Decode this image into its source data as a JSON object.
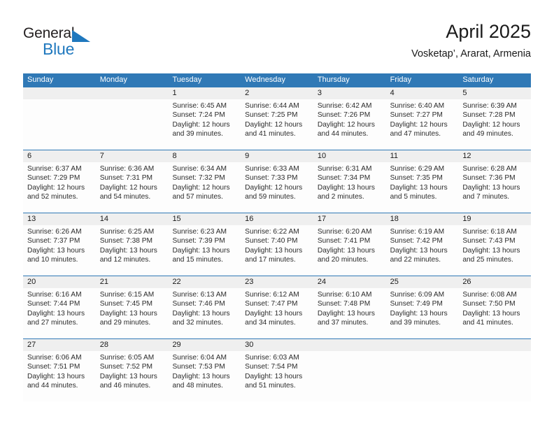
{
  "brand": {
    "name_part1": "General",
    "name_part2": "Blue",
    "triangle_color": "#1f78be"
  },
  "header": {
    "title": "April 2025",
    "subtitle": "Vosketap’, Ararat, Armenia"
  },
  "theme": {
    "header_bg": "#3079b6",
    "daynum_bg": "#efefef",
    "cell_bg": "#fdfdfd",
    "text": "#1a1a1a"
  },
  "weekday_headers": [
    "Sunday",
    "Monday",
    "Tuesday",
    "Wednesday",
    "Thursday",
    "Friday",
    "Saturday"
  ],
  "weeks": [
    [
      {
        "day": "",
        "l1": "",
        "l2": "",
        "l3": "",
        "l4": ""
      },
      {
        "day": "",
        "l1": "",
        "l2": "",
        "l3": "",
        "l4": ""
      },
      {
        "day": "1",
        "l1": "Sunrise: 6:45 AM",
        "l2": "Sunset: 7:24 PM",
        "l3": "Daylight: 12 hours",
        "l4": "and 39 minutes."
      },
      {
        "day": "2",
        "l1": "Sunrise: 6:44 AM",
        "l2": "Sunset: 7:25 PM",
        "l3": "Daylight: 12 hours",
        "l4": "and 41 minutes."
      },
      {
        "day": "3",
        "l1": "Sunrise: 6:42 AM",
        "l2": "Sunset: 7:26 PM",
        "l3": "Daylight: 12 hours",
        "l4": "and 44 minutes."
      },
      {
        "day": "4",
        "l1": "Sunrise: 6:40 AM",
        "l2": "Sunset: 7:27 PM",
        "l3": "Daylight: 12 hours",
        "l4": "and 47 minutes."
      },
      {
        "day": "5",
        "l1": "Sunrise: 6:39 AM",
        "l2": "Sunset: 7:28 PM",
        "l3": "Daylight: 12 hours",
        "l4": "and 49 minutes."
      }
    ],
    [
      {
        "day": "6",
        "l1": "Sunrise: 6:37 AM",
        "l2": "Sunset: 7:29 PM",
        "l3": "Daylight: 12 hours",
        "l4": "and 52 minutes."
      },
      {
        "day": "7",
        "l1": "Sunrise: 6:36 AM",
        "l2": "Sunset: 7:31 PM",
        "l3": "Daylight: 12 hours",
        "l4": "and 54 minutes."
      },
      {
        "day": "8",
        "l1": "Sunrise: 6:34 AM",
        "l2": "Sunset: 7:32 PM",
        "l3": "Daylight: 12 hours",
        "l4": "and 57 minutes."
      },
      {
        "day": "9",
        "l1": "Sunrise: 6:33 AM",
        "l2": "Sunset: 7:33 PM",
        "l3": "Daylight: 12 hours",
        "l4": "and 59 minutes."
      },
      {
        "day": "10",
        "l1": "Sunrise: 6:31 AM",
        "l2": "Sunset: 7:34 PM",
        "l3": "Daylight: 13 hours",
        "l4": "and 2 minutes."
      },
      {
        "day": "11",
        "l1": "Sunrise: 6:29 AM",
        "l2": "Sunset: 7:35 PM",
        "l3": "Daylight: 13 hours",
        "l4": "and 5 minutes."
      },
      {
        "day": "12",
        "l1": "Sunrise: 6:28 AM",
        "l2": "Sunset: 7:36 PM",
        "l3": "Daylight: 13 hours",
        "l4": "and 7 minutes."
      }
    ],
    [
      {
        "day": "13",
        "l1": "Sunrise: 6:26 AM",
        "l2": "Sunset: 7:37 PM",
        "l3": "Daylight: 13 hours",
        "l4": "and 10 minutes."
      },
      {
        "day": "14",
        "l1": "Sunrise: 6:25 AM",
        "l2": "Sunset: 7:38 PM",
        "l3": "Daylight: 13 hours",
        "l4": "and 12 minutes."
      },
      {
        "day": "15",
        "l1": "Sunrise: 6:23 AM",
        "l2": "Sunset: 7:39 PM",
        "l3": "Daylight: 13 hours",
        "l4": "and 15 minutes."
      },
      {
        "day": "16",
        "l1": "Sunrise: 6:22 AM",
        "l2": "Sunset: 7:40 PM",
        "l3": "Daylight: 13 hours",
        "l4": "and 17 minutes."
      },
      {
        "day": "17",
        "l1": "Sunrise: 6:20 AM",
        "l2": "Sunset: 7:41 PM",
        "l3": "Daylight: 13 hours",
        "l4": "and 20 minutes."
      },
      {
        "day": "18",
        "l1": "Sunrise: 6:19 AM",
        "l2": "Sunset: 7:42 PM",
        "l3": "Daylight: 13 hours",
        "l4": "and 22 minutes."
      },
      {
        "day": "19",
        "l1": "Sunrise: 6:18 AM",
        "l2": "Sunset: 7:43 PM",
        "l3": "Daylight: 13 hours",
        "l4": "and 25 minutes."
      }
    ],
    [
      {
        "day": "20",
        "l1": "Sunrise: 6:16 AM",
        "l2": "Sunset: 7:44 PM",
        "l3": "Daylight: 13 hours",
        "l4": "and 27 minutes."
      },
      {
        "day": "21",
        "l1": "Sunrise: 6:15 AM",
        "l2": "Sunset: 7:45 PM",
        "l3": "Daylight: 13 hours",
        "l4": "and 29 minutes."
      },
      {
        "day": "22",
        "l1": "Sunrise: 6:13 AM",
        "l2": "Sunset: 7:46 PM",
        "l3": "Daylight: 13 hours",
        "l4": "and 32 minutes."
      },
      {
        "day": "23",
        "l1": "Sunrise: 6:12 AM",
        "l2": "Sunset: 7:47 PM",
        "l3": "Daylight: 13 hours",
        "l4": "and 34 minutes."
      },
      {
        "day": "24",
        "l1": "Sunrise: 6:10 AM",
        "l2": "Sunset: 7:48 PM",
        "l3": "Daylight: 13 hours",
        "l4": "and 37 minutes."
      },
      {
        "day": "25",
        "l1": "Sunrise: 6:09 AM",
        "l2": "Sunset: 7:49 PM",
        "l3": "Daylight: 13 hours",
        "l4": "and 39 minutes."
      },
      {
        "day": "26",
        "l1": "Sunrise: 6:08 AM",
        "l2": "Sunset: 7:50 PM",
        "l3": "Daylight: 13 hours",
        "l4": "and 41 minutes."
      }
    ],
    [
      {
        "day": "27",
        "l1": "Sunrise: 6:06 AM",
        "l2": "Sunset: 7:51 PM",
        "l3": "Daylight: 13 hours",
        "l4": "and 44 minutes."
      },
      {
        "day": "28",
        "l1": "Sunrise: 6:05 AM",
        "l2": "Sunset: 7:52 PM",
        "l3": "Daylight: 13 hours",
        "l4": "and 46 minutes."
      },
      {
        "day": "29",
        "l1": "Sunrise: 6:04 AM",
        "l2": "Sunset: 7:53 PM",
        "l3": "Daylight: 13 hours",
        "l4": "and 48 minutes."
      },
      {
        "day": "30",
        "l1": "Sunrise: 6:03 AM",
        "l2": "Sunset: 7:54 PM",
        "l3": "Daylight: 13 hours",
        "l4": "and 51 minutes."
      },
      {
        "day": "",
        "l1": "",
        "l2": "",
        "l3": "",
        "l4": ""
      },
      {
        "day": "",
        "l1": "",
        "l2": "",
        "l3": "",
        "l4": ""
      },
      {
        "day": "",
        "l1": "",
        "l2": "",
        "l3": "",
        "l4": ""
      }
    ]
  ]
}
